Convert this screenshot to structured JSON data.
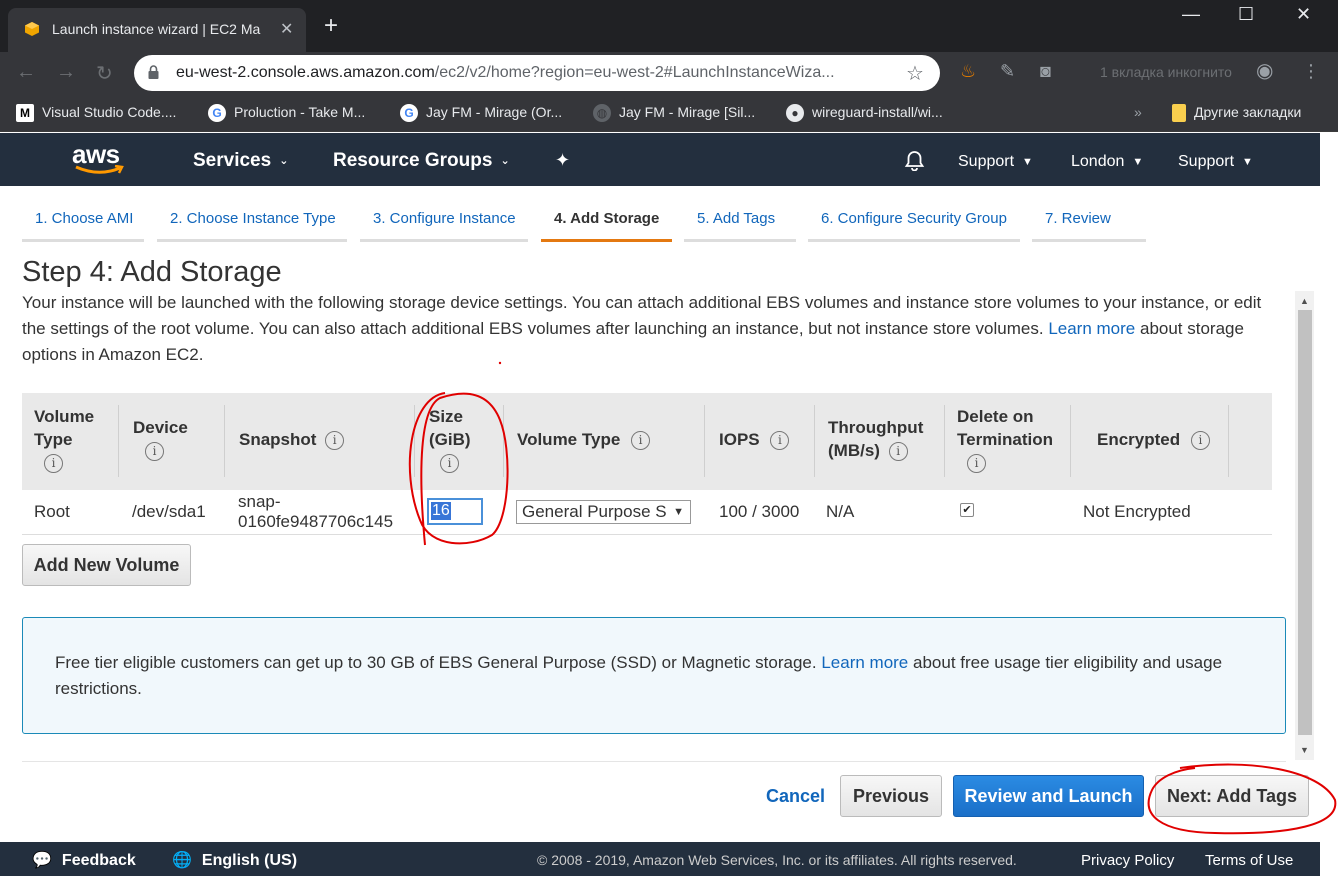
{
  "browser": {
    "tab_title": "Launch instance wizard | EC2 Ma",
    "url_host": "eu-west-2.console.aws.amazon.com",
    "url_path": "/ec2/v2/home?region=eu-west-2#LaunchInstanceWiza...",
    "incognito_label": "1 вкладка инкогнито",
    "bookmarks": [
      "Visual Studio Code....",
      "Proluction - Take M...",
      "Jay FM - Mirage (Or...",
      "Jay FM - Mirage [Sil...",
      "wireguard-install/wi..."
    ],
    "other_bookmarks": "Другие закладки",
    "more_bookmarks": "»"
  },
  "aws_header": {
    "logo": "aws",
    "services": "Services",
    "resource_groups": "Resource Groups",
    "account": "Support",
    "region": "London",
    "support": "Support"
  },
  "wizard_steps": [
    {
      "label": "1. Choose AMI",
      "active": false
    },
    {
      "label": "2. Choose Instance Type",
      "active": false
    },
    {
      "label": "3. Configure Instance",
      "active": false
    },
    {
      "label": "4. Add Storage",
      "active": true
    },
    {
      "label": "5. Add Tags",
      "active": false
    },
    {
      "label": "6. Configure Security Group",
      "active": false
    },
    {
      "label": "7. Review",
      "active": false
    }
  ],
  "page": {
    "title": "Step 4: Add Storage",
    "description_1": "Your instance will be launched with the following storage device settings. You can attach additional EBS volumes and instance store volumes to your instance, or edit the settings of the root volume. You can also attach additional EBS volumes after launching an instance, but not instance store volumes.",
    "description_link": "Learn more",
    "description_2": "about storage options in Amazon EC2."
  },
  "table": {
    "headers": {
      "volume_type_a": "Volume",
      "volume_type_b": "Type",
      "device": "Device",
      "snapshot": "Snapshot",
      "size_a": "Size",
      "size_b": "(GiB)",
      "volume_type2": "Volume Type",
      "iops": "IOPS",
      "throughput_a": "Throughput",
      "throughput_b": "(MB/s)",
      "delete_a": "Delete on",
      "delete_b": "Termination",
      "encrypted": "Encrypted"
    },
    "row": {
      "volume_type": "Root",
      "device": "/dev/sda1",
      "snapshot_a": "snap-",
      "snapshot_b": "0160fe9487706c145",
      "size": "16",
      "volume_type_select": "General Purpose S",
      "iops": "100 / 3000",
      "throughput": "N/A",
      "delete_on_termination": true,
      "encrypted": "Not Encrypted"
    }
  },
  "buttons": {
    "add_volume": "Add New Volume",
    "cancel": "Cancel",
    "previous": "Previous",
    "review_launch": "Review and Launch",
    "next": "Next: Add Tags"
  },
  "free_tier": {
    "text_1": "Free tier eligible customers can get up to 30 GB of EBS General Purpose (SSD) or Magnetic storage.",
    "link": "Learn more",
    "text_2": "about free usage tier eligibility and usage restrictions."
  },
  "footer": {
    "feedback": "Feedback",
    "language": "English (US)",
    "copyright": "© 2008 - 2019, Amazon Web Services, Inc. or its affiliates. All rights reserved.",
    "privacy": "Privacy Policy",
    "terms": "Terms of Use"
  },
  "colors": {
    "aws_nav": "#232f3e",
    "link": "#1166bb",
    "active_step": "#e47911",
    "primary_button": "#1a6fc8",
    "annotation": "#e00000"
  }
}
